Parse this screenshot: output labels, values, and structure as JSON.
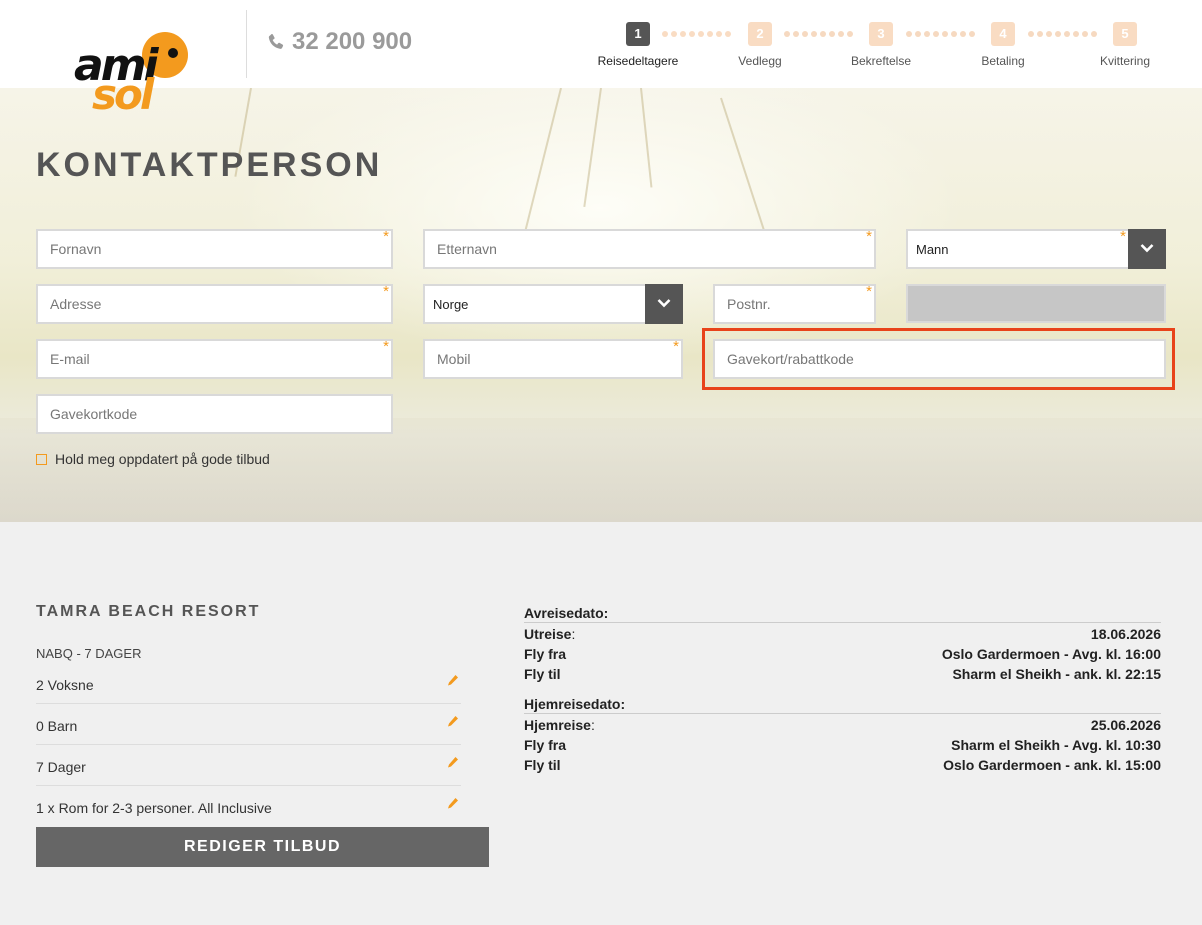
{
  "brand": {
    "logo_text_top": "ami",
    "logo_text_bottom": "sol",
    "phone": "32 200 900",
    "accent_color": "#f39a1e",
    "icons": {
      "phone": "phone-icon",
      "chevron": "chevron-down-icon",
      "edit": "pencil-icon"
    }
  },
  "steps": [
    {
      "num": "1",
      "label": "Reisedeltagere",
      "active": true
    },
    {
      "num": "2",
      "label": "Vedlegg",
      "active": false
    },
    {
      "num": "3",
      "label": "Bekreftelse",
      "active": false
    },
    {
      "num": "4",
      "label": "Betaling",
      "active": false
    },
    {
      "num": "5",
      "label": "Kvittering",
      "active": false
    }
  ],
  "contact": {
    "title": "KONTAKTPERSON",
    "required_marker": "*",
    "fields": {
      "first_name": {
        "placeholder": "Fornavn",
        "value": ""
      },
      "last_name": {
        "placeholder": "Etternavn",
        "value": ""
      },
      "gender": {
        "value": "Mann"
      },
      "address": {
        "placeholder": "Adresse",
        "value": ""
      },
      "country": {
        "value": "Norge"
      },
      "postal": {
        "placeholder": "Postnr.",
        "value": ""
      },
      "email": {
        "placeholder": "E-mail",
        "value": ""
      },
      "mobile": {
        "placeholder": "Mobil",
        "value": ""
      },
      "voucher": {
        "placeholder": "Gavekort/rabattkode",
        "value": ""
      },
      "giftcard": {
        "placeholder": "Gavekortkode",
        "value": ""
      }
    },
    "newsletter_label": "Hold meg oppdatert på gode tilbud",
    "newsletter_checked": false
  },
  "summary": {
    "hotel": "TAMRA BEACH RESORT",
    "code": "NABQ - 7 DAGER",
    "rows": [
      {
        "text": "2 Voksne"
      },
      {
        "text": "0 Barn"
      },
      {
        "text": "7 Dager"
      },
      {
        "text": "1 x Rom for 2-3 personer. All Inclusive"
      }
    ],
    "edit_button": "REDIGER TILBUD"
  },
  "trip": {
    "outbound": {
      "heading": "Avreisedato:",
      "rows": [
        {
          "key": "Utreise",
          "colon": ":",
          "value": "18.06.2026"
        },
        {
          "key": "Fly fra",
          "colon": "",
          "value": "Oslo Gardermoen - Avg. kl. 16:00"
        },
        {
          "key": "Fly til",
          "colon": "",
          "value": "Sharm el Sheikh - ank. kl. 22:15"
        }
      ]
    },
    "inbound": {
      "heading": "Hjemreisedato:",
      "rows": [
        {
          "key": "Hjemreise",
          "colon": ":",
          "value": "25.06.2026"
        },
        {
          "key": "Fly fra",
          "colon": "",
          "value": "Sharm el Sheikh - Avg. kl. 10:30"
        },
        {
          "key": "Fly til",
          "colon": "",
          "value": "Oslo Gardermoen - ank. kl. 15:00"
        }
      ]
    }
  }
}
